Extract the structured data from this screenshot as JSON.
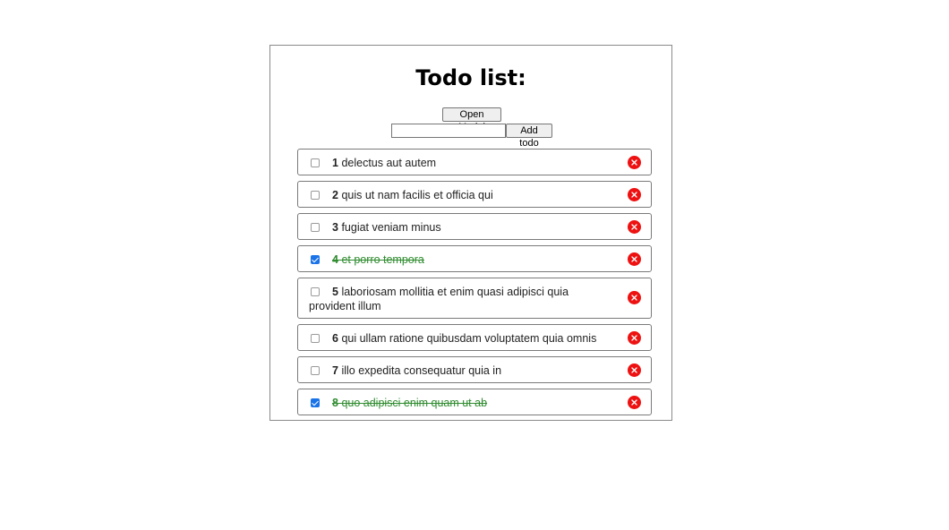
{
  "title": "Todo list:",
  "open_modal_label": "Open Modal",
  "add_input": {
    "value": "",
    "placeholder": ""
  },
  "add_button_label": "Add todo",
  "colors": {
    "completed_text": "#2e8b2e",
    "delete_icon": "#ee1111",
    "checkbox_checked": "#1a73e8"
  },
  "todos": [
    {
      "id": "1",
      "text": "delectus aut autem",
      "completed": false
    },
    {
      "id": "2",
      "text": "quis ut nam facilis et officia qui",
      "completed": false
    },
    {
      "id": "3",
      "text": "fugiat veniam minus",
      "completed": false
    },
    {
      "id": "4",
      "text": "et porro tempora",
      "completed": true
    },
    {
      "id": "5",
      "text": "laboriosam mollitia et enim quasi adipisci quia provident illum",
      "completed": false
    },
    {
      "id": "6",
      "text": "qui ullam ratione quibusdam voluptatem quia omnis",
      "completed": false
    },
    {
      "id": "7",
      "text": "illo expedita consequatur quia in",
      "completed": false
    },
    {
      "id": "8",
      "text": "quo adipisci enim quam ut ab",
      "completed": true
    }
  ],
  "icons": {
    "delete": "close-circle-icon",
    "checkbox": "checkbox-icon"
  }
}
